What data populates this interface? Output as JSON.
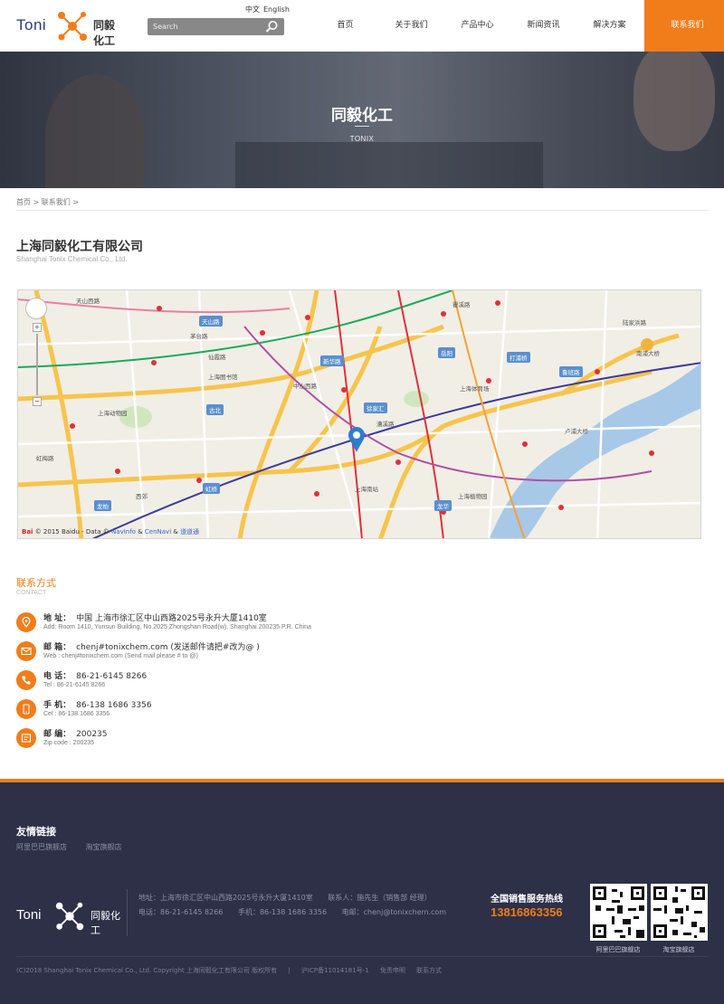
{
  "header": {
    "logo_latin": "Toni",
    "logo_cn": "同毅化工",
    "lang": [
      "中文",
      "English"
    ],
    "search_placeholder": "Search",
    "nav": [
      "首页",
      "关于我们",
      "产品中心",
      "新闻资讯",
      "解决方案",
      "联系我们"
    ],
    "nav_active": "联系我们"
  },
  "banner": {
    "title": "同毅化工",
    "subtitle": "TONIX"
  },
  "breadcrumb": {
    "home": "首页",
    "sep": ">",
    "current": "联系我们"
  },
  "company": {
    "name_cn": "上海同毅化工有限公司",
    "name_en": "Shanghai Tonix Chemical Co., Ltd."
  },
  "map": {
    "copyright_brand": "Bai",
    "copyright_text": "© 2015 Baidu - Data ©",
    "copyright_links": [
      "NavInfo",
      "CenNavi",
      "道道通"
    ],
    "labels": [
      "天山西路",
      "天山路",
      "茅台路",
      "仙霞路",
      "古北",
      "龙柏",
      "虹桥",
      "中山西路",
      "新华路",
      "徐家汇",
      "打浦桥",
      "鲁班路",
      "南浦大桥",
      "卢浦大桥",
      "岳阳",
      "上海动物园",
      "上海体育场",
      "上海南站",
      "漕溪路",
      "上海植物园",
      "陆家浜路",
      "瞿溪路",
      "宜山路",
      "交通大学",
      "上海图书馆",
      "上海火车站",
      "西郊",
      "虹梅路",
      "中山南路",
      "龙华"
    ]
  },
  "contact": {
    "title": "联系方式",
    "subtitle": "CONTACT",
    "rows": [
      {
        "icon": "location-icon",
        "label": "地 址：",
        "value": "中国 上海市徐汇区中山西路2025号永升大厦1410室",
        "en": "Add: Room 1410, Yunsun Building, No.2025 Zhongshan Road(w), Shanghai 200235 P.R. China"
      },
      {
        "icon": "mail-icon",
        "label": "邮 箱：",
        "value": "chenj#tonixchem.com (发送邮件请把#改为@ )",
        "en": "Web : chenj#tonixchem.com (Send mail please # to @)"
      },
      {
        "icon": "phone-icon",
        "label": "电 话：",
        "value": "86-21-6145 8266",
        "en": "Tel : 86-21-6145 8266"
      },
      {
        "icon": "mobile-icon",
        "label": "手 机：",
        "value": "86-138 1686 3356",
        "en": "Cel : 86-138 1686 3356"
      },
      {
        "icon": "zipcode-icon",
        "label": "邮 编：",
        "value": "200235",
        "en": "Zip code : 200235"
      }
    ]
  },
  "footer": {
    "links_title": "友情链接",
    "links": [
      "阿里巴巴旗舰店",
      "淘宝旗舰店"
    ],
    "logo_latin": "Toni",
    "logo_cn": "同毅化工",
    "info_row1": [
      "地址：上海市徐汇区中山西路2025号永升大厦1410室",
      "联系人：施先生（销售部 经理）"
    ],
    "info_row2": [
      "电话：86-21-6145 8266",
      "手机：86-138 1686 3356",
      "电邮：chenj@tonixchem.com"
    ],
    "hotline_title": "全国销售服务热线",
    "hotline_number": "13816863356",
    "qr_captions": [
      "阿里巴巴旗舰店",
      "淘宝旗舰店"
    ],
    "bottom": [
      "(C)2018 Shanghai Tonix Chemical Co., Ltd. Copyright 上海同毅化工有限公司 版权所有",
      "|",
      "沪ICP备11014181号-1",
      "免责申明",
      "联系方式"
    ]
  },
  "colors": {
    "accent": "#f07d1a",
    "footer_bg": "#2d3047",
    "link_blue": "#3366cc"
  }
}
